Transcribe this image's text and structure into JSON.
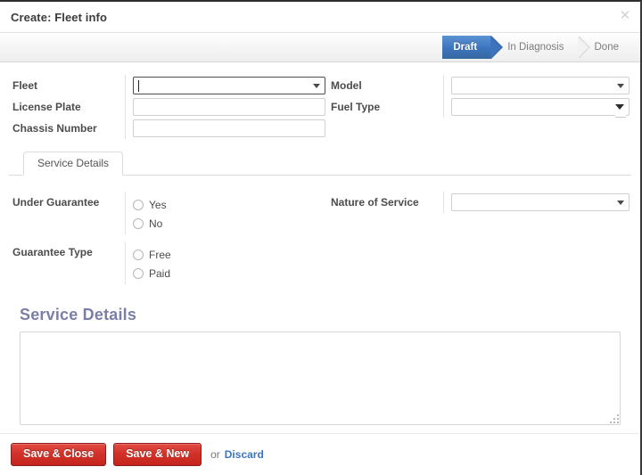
{
  "window": {
    "title": "Create: Fleet info",
    "close_icon": "close-icon",
    "close_glyph": "✕"
  },
  "status_flow": {
    "steps": [
      {
        "label": "Draft",
        "state": "active"
      },
      {
        "label": "In Diagnosis",
        "state": "inactive"
      },
      {
        "label": "Done",
        "state": "inactive"
      }
    ],
    "active_color": "#3d73bd",
    "inactive_color": "#7d7d7d"
  },
  "form": {
    "left": [
      {
        "label": "Fleet",
        "type": "select",
        "value": "",
        "focused": true,
        "icon": "chevron-down-icon"
      },
      {
        "label": "License Plate",
        "type": "text",
        "value": "",
        "placeholder": ""
      },
      {
        "label": "Chassis Number",
        "type": "text",
        "value": "",
        "placeholder": ""
      }
    ],
    "right": [
      {
        "label": "Model",
        "type": "select",
        "value": "",
        "focused": false,
        "icon": "chevron-down-icon"
      },
      {
        "label": "Fuel Type",
        "type": "select-native",
        "value": "",
        "focused": false,
        "icon": "chevron-down-icon"
      }
    ]
  },
  "tabs": [
    {
      "label": "Service Details",
      "active": true
    }
  ],
  "tab_panel": {
    "left": [
      {
        "label": "Under Guarantee",
        "type": "radio",
        "options": [
          {
            "label": "Yes",
            "checked": false
          },
          {
            "label": "No",
            "checked": false
          }
        ]
      },
      {
        "label": "Guarantee Type",
        "type": "radio",
        "options": [
          {
            "label": "Free",
            "checked": false
          },
          {
            "label": "Paid",
            "checked": false
          }
        ]
      }
    ],
    "right": [
      {
        "label": "Nature of Service",
        "type": "select",
        "value": "",
        "icon": "chevron-down-icon"
      }
    ]
  },
  "section": {
    "title": "Service Details",
    "title_color": "#7b7fa8",
    "textarea_value": "",
    "textarea_placeholder": ""
  },
  "footer": {
    "save_close_label": "Save & Close",
    "save_new_label": "Save & New",
    "or_label": "or",
    "discard_label": "Discard",
    "button_color": "#c3241d",
    "link_color": "#3a75c4"
  }
}
